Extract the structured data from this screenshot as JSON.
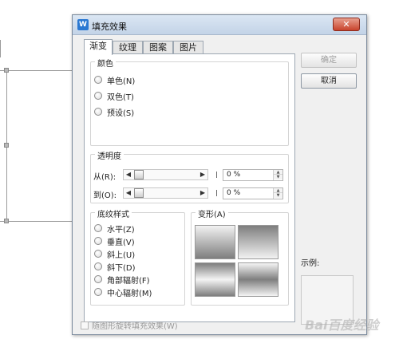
{
  "dialog": {
    "title": "填充效果",
    "app_icon": "wps-writer-icon",
    "close_symbol": "✕"
  },
  "tabs": [
    {
      "label": "渐变",
      "active": true
    },
    {
      "label": "纹理",
      "active": false
    },
    {
      "label": "图案",
      "active": false
    },
    {
      "label": "图片",
      "active": false
    }
  ],
  "color_group": {
    "title": "颜色",
    "options": [
      {
        "label": "单色(N)",
        "selected": false
      },
      {
        "label": "双色(T)",
        "selected": false
      },
      {
        "label": "预设(S)",
        "selected": false
      }
    ]
  },
  "transparency_group": {
    "title": "透明度",
    "from_label": "从(R):",
    "to_label": "到(O):",
    "from_value": "0 %",
    "to_value": "0 %",
    "from_level": 0,
    "to_level": 0
  },
  "shading_group": {
    "title": "底纹样式",
    "options": [
      {
        "label": "水平(Z)",
        "selected": false
      },
      {
        "label": "垂直(V)",
        "selected": false
      },
      {
        "label": "斜上(U)",
        "selected": false
      },
      {
        "label": "斜下(D)",
        "selected": false
      },
      {
        "label": "角部辐射(F)",
        "selected": false
      },
      {
        "label": "中心辐射(M)",
        "selected": false
      }
    ]
  },
  "variants_group": {
    "title": "变形(A)"
  },
  "buttons": {
    "ok": "确定",
    "cancel": "取消"
  },
  "preview_label": "示例:",
  "rotate_checkbox": {
    "label": "随图形旋转填充效果(W)",
    "checked": false
  },
  "watermark": "Bai百度经验",
  "colors": {
    "title_bar": "#c3d3e7",
    "close_button": "#c8432c",
    "dialog_bg": "#f0f0f0"
  }
}
